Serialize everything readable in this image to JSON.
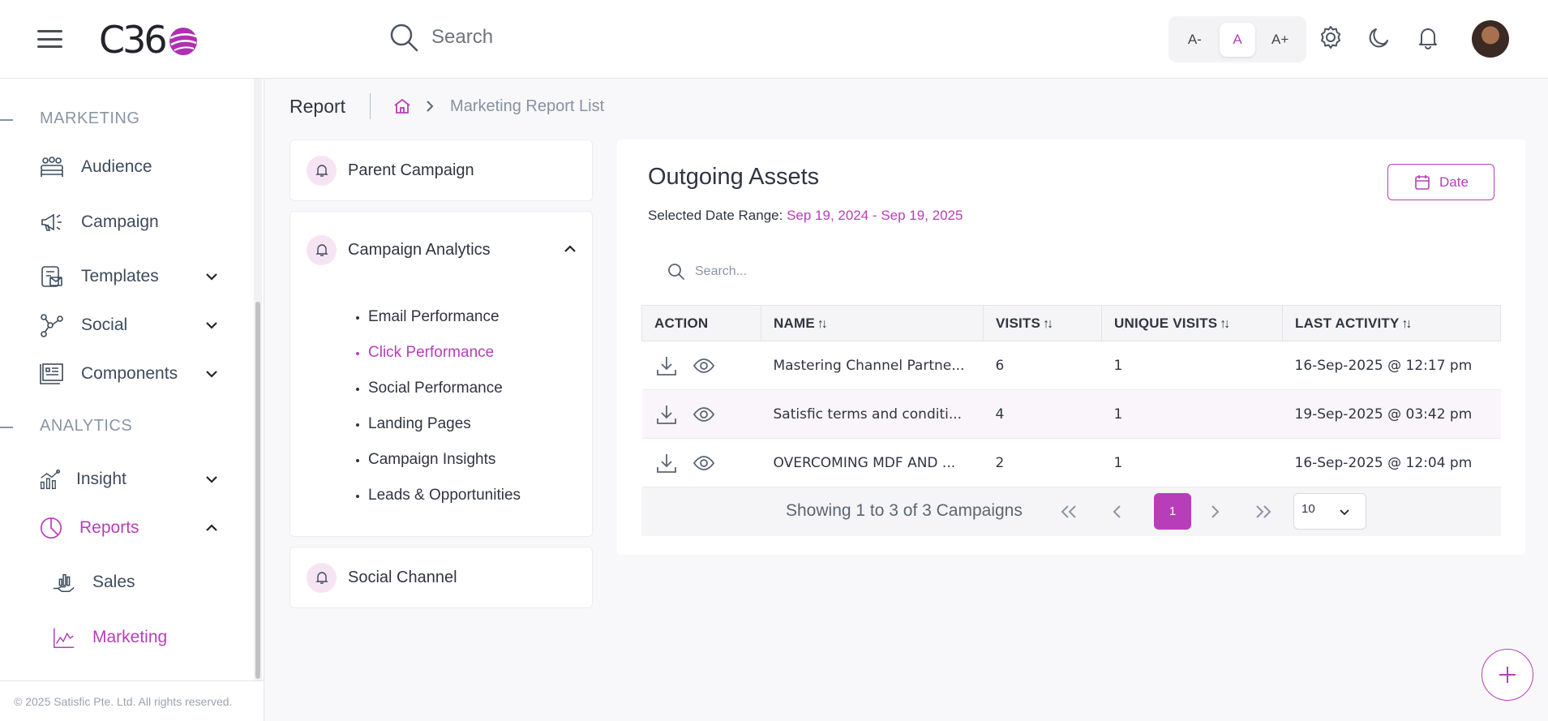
{
  "header": {
    "logo_text": "C36",
    "search_placeholder": "Search",
    "font_size": {
      "smaller": "A-",
      "normal": "A",
      "larger": "A+"
    }
  },
  "sidebar": {
    "sections": [
      {
        "title": "MARKETING"
      },
      {
        "title": "ANALYTICS"
      }
    ],
    "items": [
      {
        "label": "Audience",
        "icon": "audience-icon"
      },
      {
        "label": "Campaign",
        "icon": "megaphone-icon"
      },
      {
        "label": "Templates",
        "icon": "templates-icon"
      },
      {
        "label": "Social",
        "icon": "social-network-icon"
      },
      {
        "label": "Components",
        "icon": "components-icon"
      },
      {
        "label": "Insight",
        "icon": "insight-chart-icon"
      },
      {
        "label": "Reports",
        "icon": "pie-chart-icon"
      }
    ],
    "sub_items": [
      {
        "label": "Sales",
        "icon": "sales-icon"
      },
      {
        "label": "Marketing",
        "icon": "line-chart-icon"
      }
    ],
    "footer": "© 2025 Satisfic Pte. Ltd. All rights reserved."
  },
  "breadcrumb": {
    "title": "Report",
    "current": "Marketing Report List"
  },
  "left_panel": {
    "parent_campaign": "Parent Campaign",
    "campaign_analytics": "Campaign Analytics",
    "analytics_items": [
      "Email Performance",
      "Click Performance",
      "Social Performance",
      "Landing Pages",
      "Campaign Insights",
      "Leads & Opportunities"
    ],
    "active_item": "Click Performance",
    "social_channel": "Social Channel"
  },
  "main": {
    "title": "Outgoing Assets",
    "date_range_label": "Selected Date Range: ",
    "date_range_value": "Sep 19, 2024 - Sep 19, 2025",
    "date_button": "Date",
    "table_search_placeholder": "Search...",
    "columns": [
      "ACTION",
      "NAME",
      "VISITS",
      "UNIQUE VISITS",
      "LAST ACTIVITY"
    ],
    "rows": [
      {
        "name": "Mastering Channel Partne...",
        "visits": "6",
        "unique_visits": "1",
        "last_activity": "16-Sep-2025 @ 12:17 pm"
      },
      {
        "name": "Satisfic terms and conditi...",
        "visits": "4",
        "unique_visits": "1",
        "last_activity": "19-Sep-2025 @ 03:42 pm"
      },
      {
        "name": "OVERCOMING MDF AND ...",
        "visits": "2",
        "unique_visits": "1",
        "last_activity": "16-Sep-2025 @ 12:04 pm"
      }
    ],
    "pagination": {
      "summary": "Showing 1 to 3 of 3 Campaigns",
      "current_page": "1",
      "page_size": "10"
    }
  },
  "colors": {
    "accent": "#b83eb9",
    "text": "#2f3542",
    "muted": "#8a94a6"
  }
}
